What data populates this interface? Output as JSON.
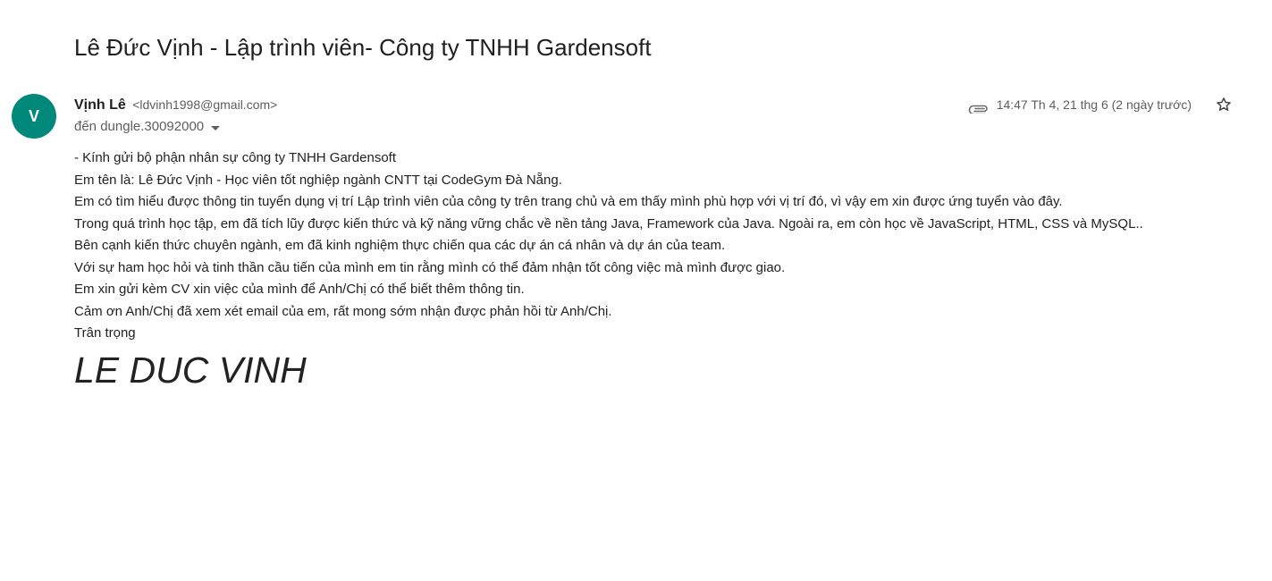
{
  "email": {
    "subject": "Lê Đức Vịnh - Lập trình viên- Công ty TNHH Gardensoft",
    "sender": {
      "avatar_letter": "V",
      "avatar_color": "#00897b",
      "name": "Vịnh Lê",
      "email": "<ldvinh1998@gmail.com>"
    },
    "recipient": "đến dungle.30092000",
    "timestamp": "14:47 Th 4, 21 thg 6 (2 ngày trước)",
    "icons": {
      "attachment": "paperclip-icon",
      "star": "star-icon",
      "recipient_details": "caret-down-icon"
    },
    "body_lines": [
      "- Kính gửi bộ phận nhân sự công ty TNHH Gardensoft",
      "Em tên là: Lê Đức Vịnh - Học viên tốt nghiệp ngành CNTT tại CodeGym Đà Nẵng.",
      "Em có tìm hiểu được thông tin tuyển dụng vị trí Lập trình viên của công ty trên trang chủ và em thấy mình phù hợp với vị trí đó, vì vậy em xin được ứng tuyển vào đây.",
      "Trong quá trình học tập, em đã tích lũy được kiến thức và kỹ năng vững chắc về nền tảng Java, Framework của Java. Ngoài ra, em còn học về JavaScript, HTML, CSS và MySQL..",
      "Bên cạnh kiến thức chuyên ngành, em đã kinh nghiệm thực chiến qua các dự án cá nhân và dự án của team.",
      "Với sự ham học hỏi và tinh thần cầu tiến của mình em tin rằng mình có thể đảm nhận tốt công việc mà mình được giao.",
      "Em xin gửi kèm CV xin việc của mình để Anh/Chị có thể biết thêm thông tin.",
      "Cảm ơn Anh/Chị đã xem xét email của em, rất mong sớm nhận được phản hồi từ Anh/Chị.",
      "Trân trọng"
    ],
    "signature": "LE DUC VINH"
  }
}
